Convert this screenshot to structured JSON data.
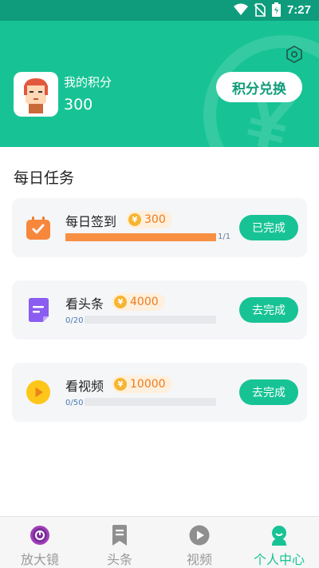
{
  "status_bar": {
    "time": "7:27"
  },
  "header": {
    "points_label": "我的积分",
    "points_value": "300",
    "exchange_button": "积分兑换"
  },
  "section_title": "每日任务",
  "tasks": [
    {
      "title": "每日签到",
      "reward": "300",
      "progress_text": "1/1",
      "progress_fraction": 1.0,
      "button": "已完成",
      "icon": "calendar-check-icon"
    },
    {
      "title": "看头条",
      "reward": "4000",
      "progress_text": "0/20",
      "progress_fraction": 0,
      "button": "去完成",
      "icon": "document-icon"
    },
    {
      "title": "看视频",
      "reward": "10000",
      "progress_text": "0/50",
      "progress_fraction": 0,
      "button": "去完成",
      "icon": "play-icon"
    }
  ],
  "tabbar": {
    "items": [
      {
        "label": "放大镜",
        "icon": "magnifier-icon",
        "active": false
      },
      {
        "label": "头条",
        "icon": "bookmark-icon",
        "active": false
      },
      {
        "label": "视频",
        "icon": "play-circle-icon",
        "active": false
      },
      {
        "label": "个人中心",
        "icon": "profile-icon",
        "active": true
      }
    ]
  },
  "colors": {
    "accent": "#17C395",
    "status_bar": "#0E9C7C",
    "reward_orange": "#EE7A1C",
    "progress_orange": "#F79043"
  }
}
